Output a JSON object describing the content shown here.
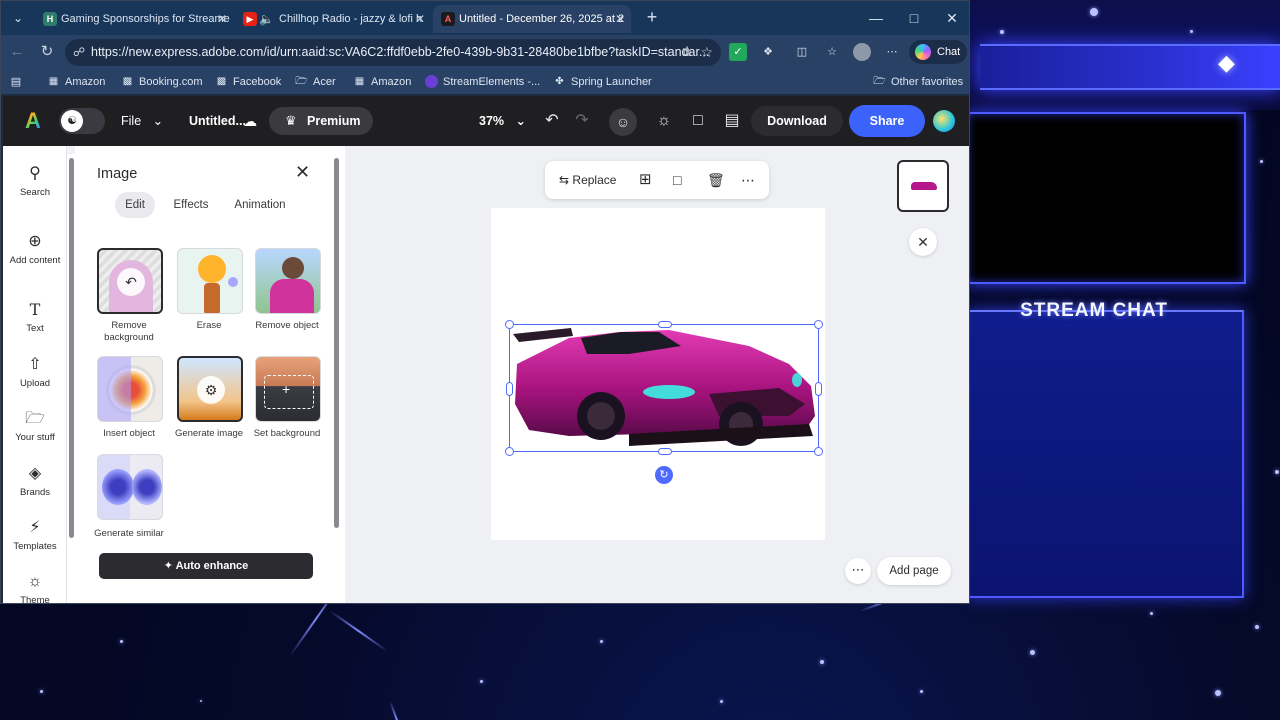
{
  "browser": {
    "tabs": [
      {
        "label": "Gaming Sponsorships for Streame",
        "favicon": "H",
        "color": "#2d7d6a"
      },
      {
        "label": "Chillhop Radio - jazzy & lofi h",
        "favicon": "▶",
        "color": "#e62117"
      },
      {
        "label": "Untitled - December 26, 2025 at 2",
        "favicon": "A",
        "color": "#1b1b1f"
      }
    ],
    "url": "https://new.express.adobe.com/id/urn:aaid:sc:VA6C2:ffdf0ebb-2fe0-439b-9b31-28480be1bfbe?taskID=standar...",
    "chat_label": "Chat",
    "bookmarks": [
      {
        "label": "Amazon",
        "icon": "amazon-icon"
      },
      {
        "label": "Booking.com",
        "icon": "booking-icon"
      },
      {
        "label": "Facebook",
        "icon": "facebook-icon"
      },
      {
        "label": "Acer",
        "icon": "folder-icon"
      },
      {
        "label": "Amazon",
        "icon": "amazon-icon"
      },
      {
        "label": "StreamElements -...",
        "icon": "streamelements-icon"
      },
      {
        "label": "Spring Launcher",
        "icon": "spring-icon"
      },
      {
        "label": "Other favorites",
        "icon": "folder-icon"
      }
    ]
  },
  "app": {
    "file_label": "File",
    "doc_title": "Untitled...",
    "premium_label": "Premium",
    "zoom": "37%",
    "download_label": "Download",
    "share_label": "Share",
    "accent": "#3b63fb"
  },
  "rail": [
    {
      "label": "Search",
      "icon": "search-icon"
    },
    {
      "label": "Add content",
      "icon": "plus-circle-icon"
    },
    {
      "label": "Text",
      "icon": "text-icon"
    },
    {
      "label": "Upload",
      "icon": "upload-icon"
    },
    {
      "label": "Your stuff",
      "icon": "folder-icon"
    },
    {
      "label": "Brands",
      "icon": "brands-icon"
    },
    {
      "label": "Templates",
      "icon": "templates-icon"
    },
    {
      "label": "Theme",
      "icon": "palette-icon"
    }
  ],
  "panel": {
    "title": "Image",
    "tabs": [
      "Edit",
      "Effects",
      "Animation"
    ],
    "tools": [
      {
        "label": "Remove background"
      },
      {
        "label": "Erase"
      },
      {
        "label": "Remove object"
      },
      {
        "label": "Insert object"
      },
      {
        "label": "Generate image"
      },
      {
        "label": "Set background"
      },
      {
        "label": "Generate similar"
      }
    ],
    "auto_enhance": "Auto enhance"
  },
  "canvas": {
    "toolbar": {
      "replace": "Replace"
    },
    "add_page": "Add page"
  },
  "overlay": {
    "chat_title": "STREAM CHAT"
  }
}
